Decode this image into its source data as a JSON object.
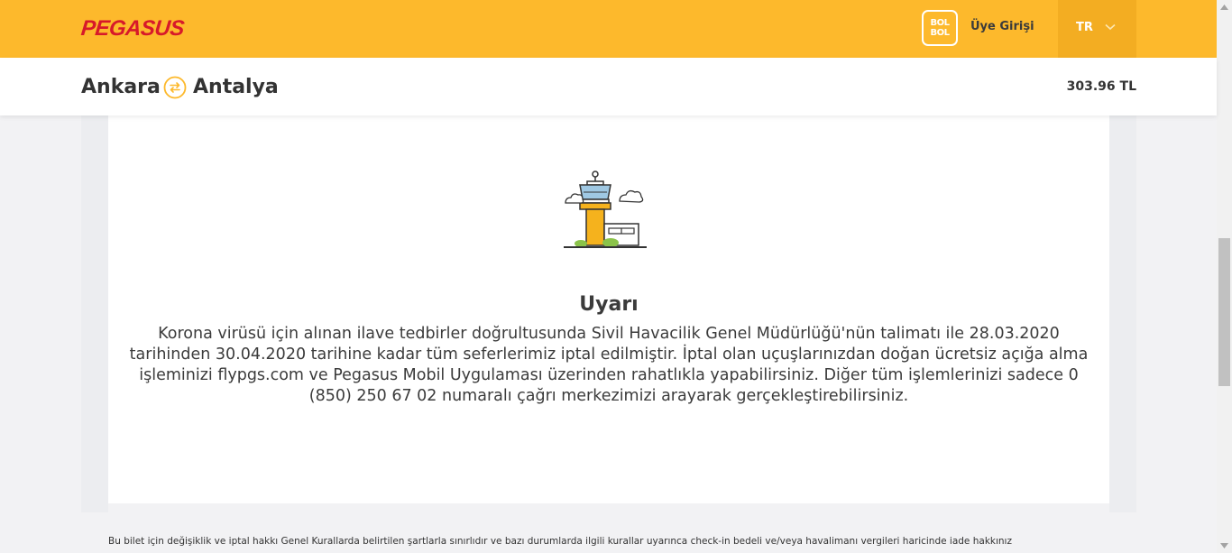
{
  "header": {
    "logo": "PEGASUS",
    "bolbol_line1": "BOL",
    "bolbol_line2": "BOL",
    "login": "Üye Girişi",
    "language": "TR"
  },
  "route": {
    "from": "Ankara",
    "to": "Antalya",
    "price": "303.96 TL"
  },
  "notice": {
    "title": "Uyarı",
    "body": "Korona virüsü için alınan ilave tedbirler doğrultusunda Sivil Havacilik Genel Müdürlüğü'nün talimatı ile 28.03.2020 tarihinden 30.04.2020 tarihine kadar tüm seferlerimiz iptal edilmiştir. İptal olan uçuşlarınızdan doğan ücretsiz açığa alma işleminizi flypgs.com ve Pegasus Mobil Uygulaması üzerinden rahatlıkla yapabilirsiniz. Diğer tüm işlemlerinizi sadece 0 (850) 250 67 02 numaralı çağrı merkezimizi arayarak gerçekleştirebilirsiniz."
  },
  "footer": {
    "note": "Bu bilet için değişiklik ve iptal hakkı Genel Kurallarda belirtilen şartlarla sınırlıdır ve bazı durumlarda ilgili kurallar uyarınca check-in bedeli ve/veya havalimanı vergileri haricinde iade hakkınız"
  },
  "icons": {
    "swap": "swap-arrows-icon",
    "tower": "control-tower-icon",
    "chevron": "chevron-down-icon"
  },
  "colors": {
    "brand_yellow": "#fdb92c",
    "brand_red": "#d7192a",
    "lang_bg": "#f3ad22"
  }
}
